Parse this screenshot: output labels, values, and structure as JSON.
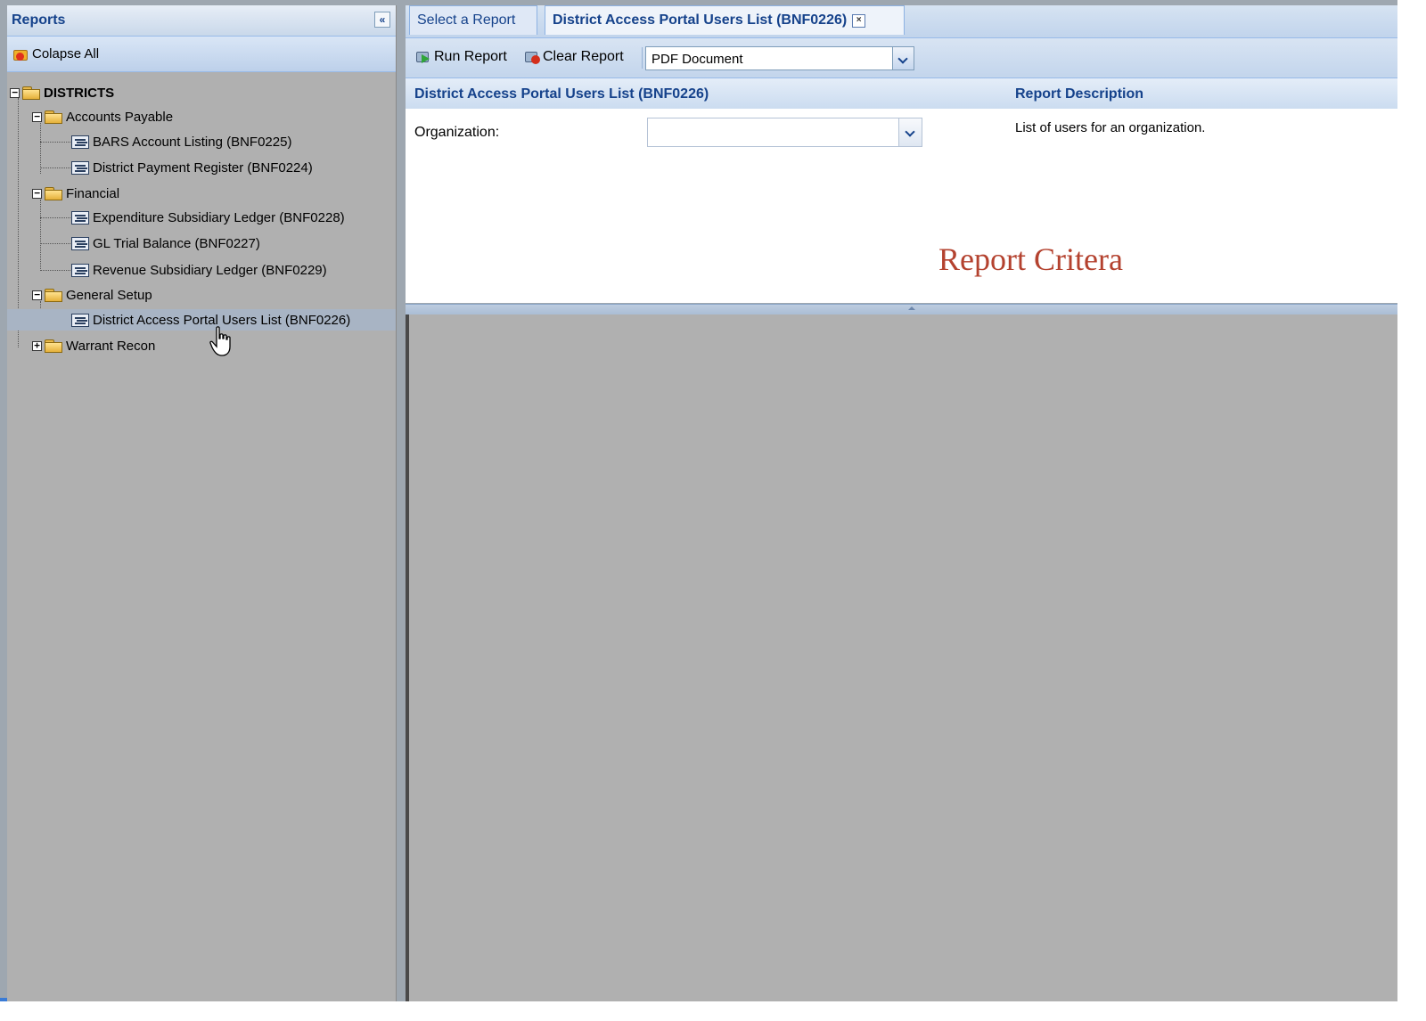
{
  "left_panel": {
    "title": "Reports",
    "collapse_button": "«",
    "collapse_all_label": "Colapse All",
    "tree": {
      "root": "DISTRICTS",
      "folders": [
        {
          "label": "Accounts Payable",
          "expanded": true,
          "items": [
            "BARS Account Listing (BNF0225)",
            "District Payment Register (BNF0224)"
          ]
        },
        {
          "label": "Financial",
          "expanded": true,
          "items": [
            "Expenditure Subsidiary Ledger (BNF0228)",
            "GL Trial Balance (BNF0227)",
            "Revenue Subsidiary Ledger (BNF0229)"
          ]
        },
        {
          "label": "General Setup",
          "expanded": true,
          "items": [
            "District Access Portal Users List (BNF0226)"
          ]
        },
        {
          "label": "Warrant Recon",
          "expanded": false,
          "items": []
        }
      ],
      "selected": "District Access Portal Users List (BNF0226)"
    }
  },
  "tabs": [
    {
      "label": "Select a Report",
      "active": false
    },
    {
      "label": "District Access Portal Users List (BNF0226)",
      "active": true,
      "close": "×"
    }
  ],
  "toolbar": {
    "run_label": "Run Report",
    "clear_label": "Clear Report",
    "format_value": "PDF Document"
  },
  "criteria": {
    "report_name": "District Access Portal Users List (BNF0226)",
    "description_header": "Report Description",
    "organization_label": "Organization:",
    "organization_value": "",
    "description_text": "List of users for an organization.",
    "caption": "Report Critera"
  },
  "colors": {
    "header_text": "#15428b",
    "caption_red": "#b4422f",
    "panel_gray": "#b0b0b0"
  }
}
